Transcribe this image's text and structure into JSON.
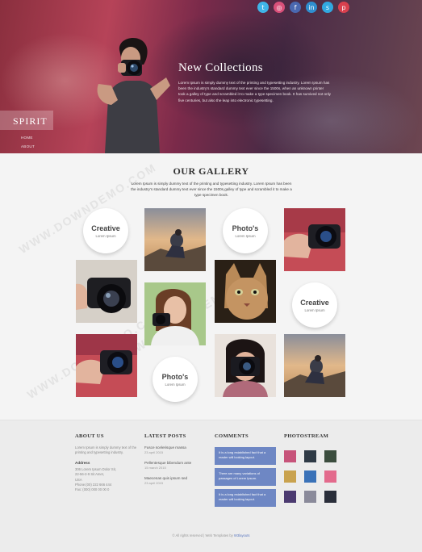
{
  "social": {
    "icons": [
      {
        "name": "twitter-icon",
        "glyph": "t",
        "color": "#3fb5e8"
      },
      {
        "name": "instagram-icon",
        "glyph": "◎",
        "color": "#d9507a"
      },
      {
        "name": "facebook-icon",
        "glyph": "f",
        "color": "#4a68b0"
      },
      {
        "name": "linkedin-icon",
        "glyph": "in",
        "color": "#2f8fd0"
      },
      {
        "name": "skype-icon",
        "glyph": "s",
        "color": "#31a9e0"
      },
      {
        "name": "pinterest-icon",
        "glyph": "p",
        "color": "#d9404e"
      }
    ]
  },
  "hero": {
    "title": "New Collections",
    "description": "Lorem Ipsum is simply dummy text of the printing and typesetting industry. Lorem Ipsum has been the industry's standard dummy text ever since the 1500s, when an unknown printer took a galley of type and scrambled it to make a type specimen book. It has survived not only five centuries, but also the leap into electronic typesetting."
  },
  "brand": {
    "logo": "SPIRIT"
  },
  "nav": {
    "items": [
      "HOME",
      "ABOUT"
    ]
  },
  "gallery": {
    "title": "OUR GALLERY",
    "description": "Lorem Ipsum is simply dummy text of the printing and typesetting industry. Lorem Ipsum has been the industry's standard dummy text ever since the 1500s,galley of type and scrambled it to make a type specimen book.",
    "circles": [
      {
        "title": "Creative",
        "sub": "Lorem Ipsum"
      },
      {
        "title": "Photo's",
        "sub": "Lorem Ipsum"
      },
      {
        "title": "Creative",
        "sub": "Lorem Ipsum"
      },
      {
        "title": "Photo's",
        "sub": "Lorem Ipsum"
      }
    ]
  },
  "watermark": "WWW.DOWNDEMO.COM",
  "footer": {
    "about": {
      "heading": "ABOUT US",
      "text": "Lorem Ipsum is simply dummy text of the printing and typesetting industry.",
      "address_heading": "Address",
      "address_lines": [
        "306 Lorem Ipsum Dolor Sit,",
        "22-56-2-9 Sit Amet,",
        "USA",
        "Phone:(00) 222 666 444",
        "Fax: (000) 000 00 00 0"
      ]
    },
    "latest": {
      "heading": "LATEST POSTS",
      "posts": [
        {
          "title": "Fusce scelerisque massa",
          "date": "23 april 2015"
        },
        {
          "title": "Pellentesque bibendum ante",
          "date": "15 march 2015"
        },
        {
          "title": "Maecenas quis ipsum sed",
          "date": "23 april 2015"
        }
      ]
    },
    "comments": {
      "heading": "COMMENTS",
      "items": [
        "It is a long established fact that a reader will looking layout.",
        "There are many variations of passages of Lorem Ipsum.",
        "It is a long established fact that a reader will looking layout."
      ]
    },
    "photostream": {
      "heading": "PHOTOSTREAM",
      "colors": [
        "#c7537a",
        "#2f3a46",
        "#3b4d3e",
        "#c9a24e",
        "#3a72b8",
        "#e36a8c",
        "#4b3a70",
        "#8a8a9a",
        "#2a2e3a"
      ]
    },
    "copyright": {
      "text": "© All rights reserved | Web Templates by",
      "link": "W3layouts"
    }
  }
}
